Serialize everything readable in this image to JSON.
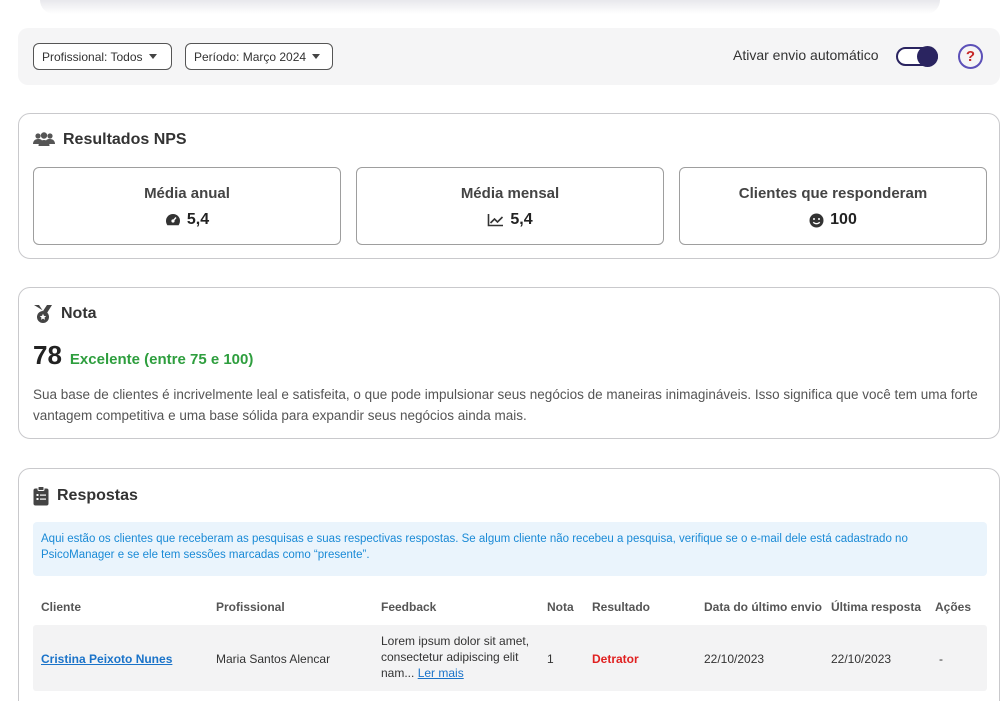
{
  "filters": {
    "professional": "Profissional: Todos",
    "period": "Período: Março 2024",
    "auto_send_label": "Ativar envio automático",
    "help": "?"
  },
  "nps": {
    "title": "Resultados NPS",
    "stats": [
      {
        "label": "Média anual",
        "value": "5,4",
        "icon": "gauge-icon"
      },
      {
        "label": "Média mensal",
        "value": "5,4",
        "icon": "trend-chart-icon"
      },
      {
        "label": "Clientes que responderam",
        "value": "100",
        "icon": "smile-icon"
      }
    ]
  },
  "nota": {
    "title": "Nota",
    "score": "78",
    "classification": "Excelente (entre 75 e 100)",
    "description": "Sua base de clientes é incrivelmente leal e satisfeita, o que pode impulsionar seus negócios de maneiras inimagináveis. Isso significa que você tem uma forte vantagem competitiva e uma base sólida para expandir seus negócios ainda mais."
  },
  "responses": {
    "title": "Respostas",
    "info": "Aqui estão os clientes que receberam as pesquisas e suas respectivas respostas. Se algum cliente não recebeu a pesquisa, verifique se o e-mail dele está cadastrado no PsicoManager e se ele tem sessões marcadas como “presente”.",
    "columns": {
      "client": "Cliente",
      "professional": "Profissional",
      "feedback": "Feedback",
      "score": "Nota",
      "result": "Resultado",
      "last_sent": "Data do último envio",
      "last_response": "Última resposta",
      "actions": "Ações"
    },
    "rows": [
      {
        "client": "Cristina Peixoto Nunes",
        "professional": "Maria Santos Alencar",
        "feedback": "Lorem ipsum dolor sit amet, consectetur adipiscing elit nam...",
        "read_more": "Ler mais",
        "score": "1",
        "result": "Detrator",
        "last_sent": "22/10/2023",
        "last_response": "22/10/2023",
        "actions": "-"
      }
    ]
  },
  "colors": {
    "accent": "#2a2460",
    "success": "#2e9e3e",
    "danger": "#e02020",
    "link": "#1a73c9",
    "info_bg": "#eaf4fc"
  }
}
